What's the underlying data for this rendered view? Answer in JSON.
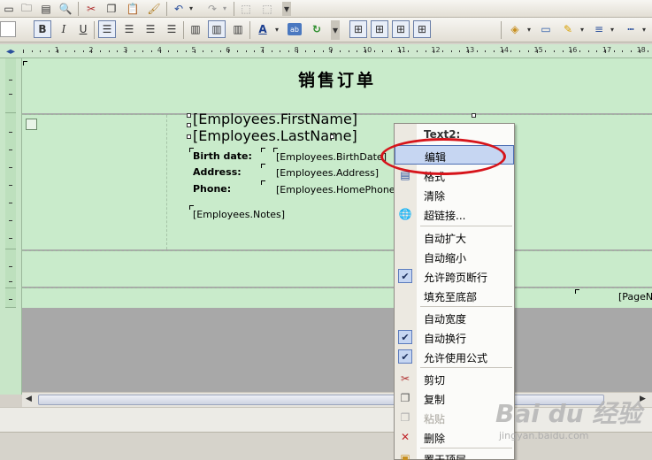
{
  "toolbar": {
    "bold_label": "B",
    "italic_label": "I",
    "underline_label": "U",
    "font_color_label": "A",
    "ab_label": "ab",
    "dropdown_glyph": "▾"
  },
  "ruler": {
    "numbers": [
      "1",
      "2",
      "3",
      "4",
      "5",
      "6",
      "7",
      "8",
      "9",
      "10",
      "11",
      "12",
      "13",
      "14",
      "15",
      "16",
      "17",
      "18"
    ]
  },
  "report": {
    "title": "销售订单",
    "first_name_field": "[Employees.FirstName]",
    "last_name_field": "[Employees.LastName]",
    "birth_label": "Birth date:",
    "address_label": "Address:",
    "phone_label": "Phone:",
    "birth_field": "[Employees.BirthDate]",
    "address_field": "[Employees.Address]",
    "phone_field": "[Employees.HomePhone]",
    "notes_field": "[Employees.Notes]",
    "page_field": "[PageN]"
  },
  "context_menu": {
    "header": "Text2:",
    "items": [
      {
        "label": "编辑",
        "icon": "",
        "highlighted": true
      },
      {
        "label": "格式",
        "icon": "format-icon"
      },
      {
        "label": "清除",
        "icon": ""
      },
      {
        "label": "超链接...",
        "icon": "hyperlink-globe-icon"
      },
      {
        "label": "自动扩大",
        "icon": ""
      },
      {
        "label": "自动缩小",
        "icon": ""
      },
      {
        "label": "允许跨页断行",
        "icon": "check-icon",
        "checked": true
      },
      {
        "label": "填充至底部",
        "icon": ""
      },
      {
        "label": "自动宽度",
        "icon": ""
      },
      {
        "label": "自动换行",
        "icon": "check-icon",
        "checked": true
      },
      {
        "label": "允许使用公式",
        "icon": "check-icon",
        "checked": true
      },
      {
        "label": "剪切",
        "icon": "scissors-icon"
      },
      {
        "label": "复制",
        "icon": "copy-icon"
      },
      {
        "label": "粘贴",
        "icon": "paste-icon",
        "disabled": true
      },
      {
        "label": "删除",
        "icon": "delete-x-icon"
      },
      {
        "label": "置于顶层",
        "icon": "bring-front-icon"
      }
    ],
    "check_glyph": "✔"
  },
  "watermark": {
    "logo": "Bai du 经验",
    "sub": "jingyan.baidu.com"
  },
  "colors": {
    "band_green": "#c9ebcb",
    "highlight_ellipse": "#d6141b",
    "menu_highlight": "#c6d6f2"
  }
}
